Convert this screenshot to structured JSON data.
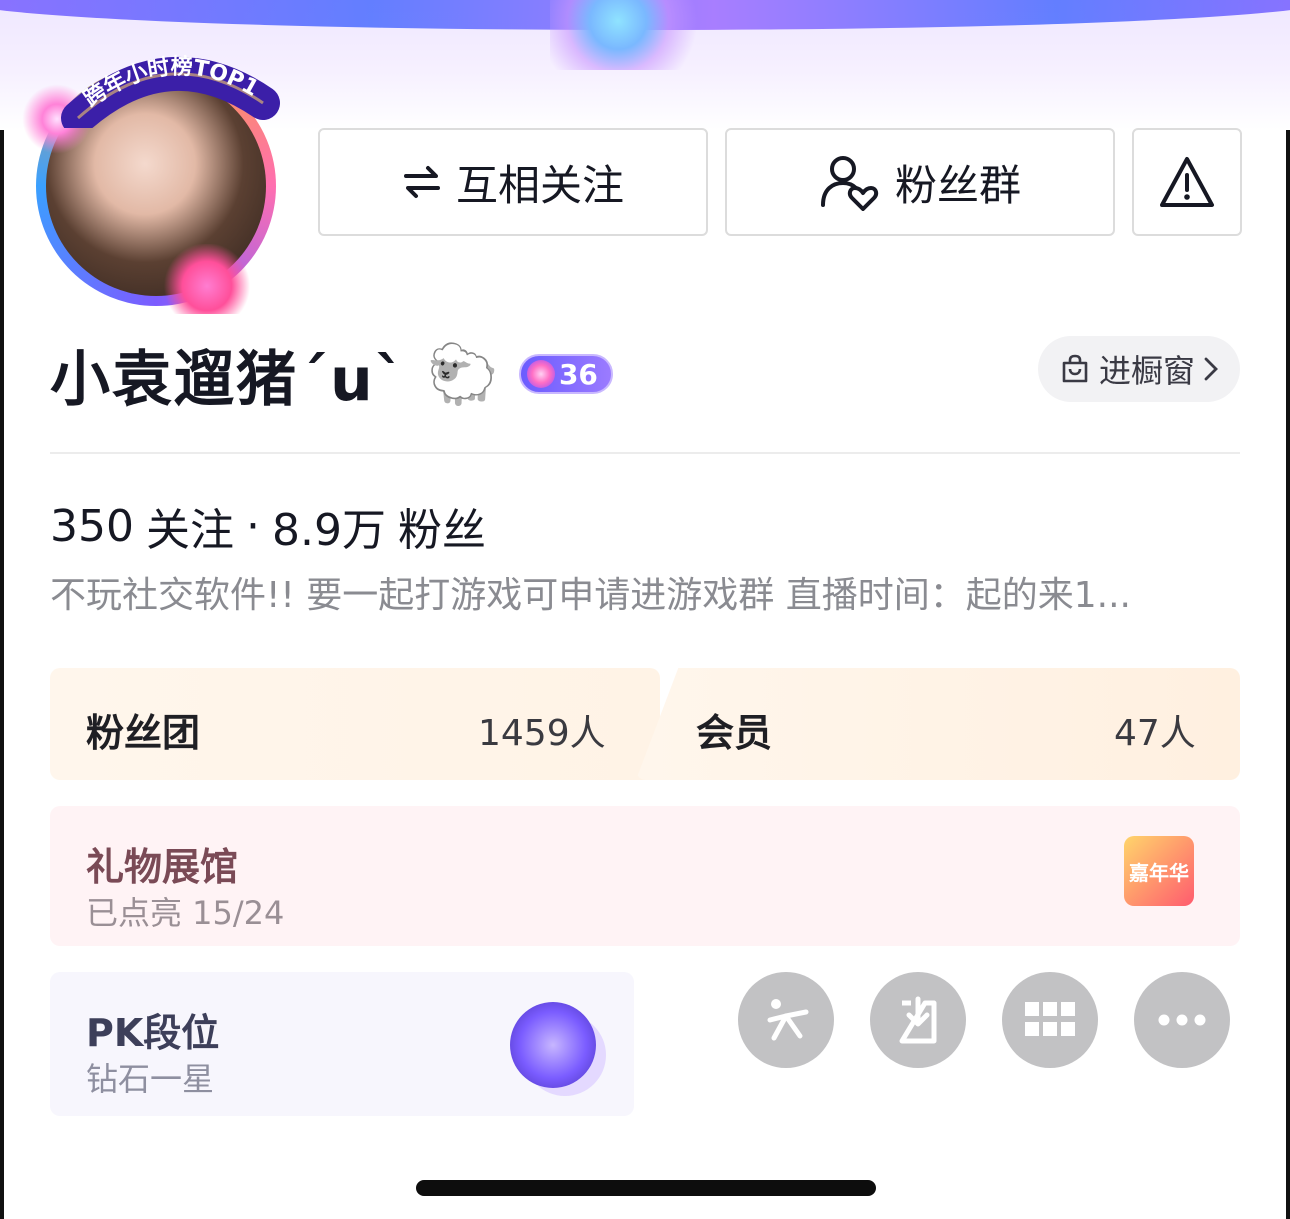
{
  "banner": {
    "rank_badge": "跨年小时榜TOP1"
  },
  "actions": {
    "mutual_follow_label": "互相关注",
    "fan_group_label": "粉丝群"
  },
  "profile": {
    "nickname": "小袁遛猪ˊuˋ",
    "emoji": "🐑",
    "level": "36",
    "showcase_label": "进橱窗"
  },
  "stats": {
    "following_count": "350",
    "following_label": "关注",
    "separator": "·",
    "followers_count": "8.9万",
    "followers_label": "粉丝"
  },
  "bio": "不玩社交软件!!  要一起打游戏可申请进游戏群 直播时间：起的来1...",
  "cards": {
    "fanclub": {
      "label": "粉丝团",
      "count": "1459人"
    },
    "member": {
      "label": "会员",
      "count": "47人"
    },
    "gift_hall": {
      "title": "礼物展馆",
      "subtitle": "已点亮 15/24",
      "icon_text": "嘉年华"
    },
    "pk": {
      "title": "PK段位",
      "subtitle": "钻石一星"
    }
  },
  "icons": {
    "mutual": "swap-arrows-icon",
    "fans": "users-heart-icon",
    "report": "warning-icon",
    "showcase": "shopping-bag-icon",
    "chevron": "chevron-right-icon",
    "circle_buttons": [
      "sparkle-icon",
      "download-icon",
      "grid-icon",
      "more-icon"
    ]
  },
  "colors": {
    "accent_purple": "#7b5cff",
    "button_gray": "#c2c2c4",
    "text_primary": "#161823",
    "text_secondary": "#8a8b91"
  }
}
